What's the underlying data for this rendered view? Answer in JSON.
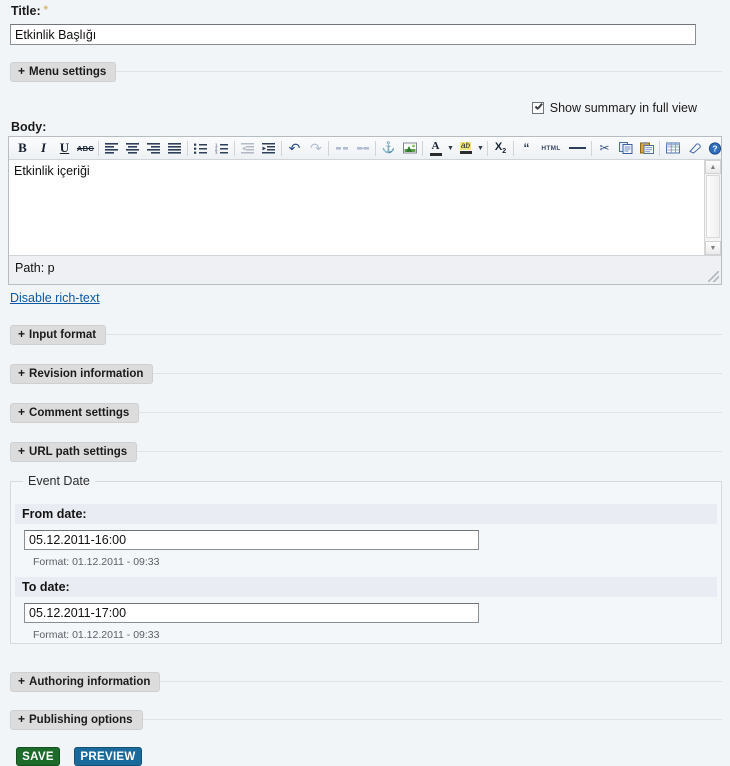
{
  "form": {
    "title_label": "Title:",
    "title_required_mark": "*",
    "title_value": "Etkinlik Başlığı",
    "body_label": "Body:",
    "body_value": "Etkinlik içeriği",
    "path_text": "Path: p",
    "disable_rich_text": "Disable rich-text",
    "summary_checkbox_label": "Show summary in full view"
  },
  "collapsibles": [
    {
      "label": "Menu settings",
      "plus": "+"
    },
    {
      "label": "Input format",
      "plus": "+"
    },
    {
      "label": "Revision information",
      "plus": "+"
    },
    {
      "label": "Comment settings",
      "plus": "+"
    },
    {
      "label": "URL path settings",
      "plus": "+"
    },
    {
      "label": "Authoring information",
      "plus": "+"
    },
    {
      "label": "Publishing options",
      "plus": "+"
    }
  ],
  "event_date": {
    "legend": "Event Date",
    "from_label": "From date:",
    "from_value": "05.12.2011-16:00",
    "from_format": "Format: 01.12.2011 - 09:33",
    "to_label": "To date:",
    "to_value": "05.12.2011-17:00",
    "to_format": "Format: 01.12.2011 - 09:33"
  },
  "actions": {
    "save_label": "SAVE",
    "preview_label": "PREVIEW"
  },
  "toolbar": {
    "items": [
      {
        "name": "bold-icon",
        "glyph": "B",
        "style": "bold",
        "dim": false
      },
      {
        "name": "italic-icon",
        "glyph": "I",
        "style": "italic",
        "dim": false
      },
      {
        "name": "underline-icon",
        "glyph": "U",
        "style": "underline",
        "dim": false
      },
      {
        "name": "strikethrough-icon",
        "glyph": "ABC",
        "style": "strike",
        "dim": false
      },
      {
        "name": "align-left-icon",
        "glyph": "",
        "style": "lines-l",
        "dim": false
      },
      {
        "name": "align-center-icon",
        "glyph": "",
        "style": "lines-c",
        "dim": false
      },
      {
        "name": "align-right-icon",
        "glyph": "",
        "style": "lines-r",
        "dim": false
      },
      {
        "name": "align-justify-icon",
        "glyph": "",
        "style": "lines-j",
        "dim": false
      },
      {
        "name": "bullet-list-icon",
        "glyph": "",
        "style": "ul",
        "dim": false
      },
      {
        "name": "numbered-list-icon",
        "glyph": "",
        "style": "ol",
        "dim": false
      },
      {
        "name": "outdent-icon",
        "glyph": "",
        "style": "outdent",
        "dim": true
      },
      {
        "name": "indent-icon",
        "glyph": "",
        "style": "indent",
        "dim": false
      },
      {
        "name": "undo-icon",
        "glyph": "↺",
        "style": "undo",
        "dim": false
      },
      {
        "name": "redo-icon",
        "glyph": "↻",
        "style": "redo",
        "dim": true
      },
      {
        "name": "unlink-icon",
        "glyph": "",
        "style": "unlink",
        "dim": true
      },
      {
        "name": "link-icon",
        "glyph": "",
        "style": "link",
        "dim": true
      },
      {
        "name": "anchor-icon",
        "glyph": "⚓",
        "style": "anchor",
        "dim": false
      },
      {
        "name": "image-icon",
        "glyph": "",
        "style": "image",
        "dim": false
      },
      {
        "name": "text-color-icon",
        "glyph": "A",
        "style": "fontcolor",
        "dim": false
      },
      {
        "name": "text-color-dropdown-icon",
        "glyph": "▾",
        "style": "caret",
        "dim": false
      },
      {
        "name": "highlight-color-icon",
        "glyph": "ab",
        "style": "highlight",
        "dim": false
      },
      {
        "name": "highlight-dropdown-icon",
        "glyph": "▾",
        "style": "caret",
        "dim": false
      },
      {
        "name": "subscript-icon",
        "glyph": "X₂",
        "style": "sub",
        "dim": false
      },
      {
        "name": "blockquote-icon",
        "glyph": "❝",
        "style": "quote",
        "dim": false
      },
      {
        "name": "html-source-icon",
        "glyph": "HTML",
        "style": "html",
        "dim": false
      },
      {
        "name": "horizontal-rule-icon",
        "glyph": "—",
        "style": "hr",
        "dim": false
      },
      {
        "name": "cut-icon",
        "glyph": "✂",
        "style": "cut",
        "dim": false
      },
      {
        "name": "copy-icon",
        "glyph": "",
        "style": "copy",
        "dim": false
      },
      {
        "name": "paste-icon",
        "glyph": "",
        "style": "paste",
        "dim": false
      },
      {
        "name": "table-icon",
        "glyph": "",
        "style": "table",
        "dim": false
      },
      {
        "name": "remove-format-icon",
        "glyph": "",
        "style": "eraser",
        "dim": false
      },
      {
        "name": "help-icon",
        "glyph": "?",
        "style": "help",
        "dim": false
      }
    ]
  },
  "colors": {
    "page_bg": "#f2f5f8",
    "save_green": "#1c6b2a",
    "preview_blue": "#1b6a9c",
    "link_blue": "#0c5aa6",
    "legend_gray": "#dcdcdc",
    "label_band": "#e9edf3"
  }
}
